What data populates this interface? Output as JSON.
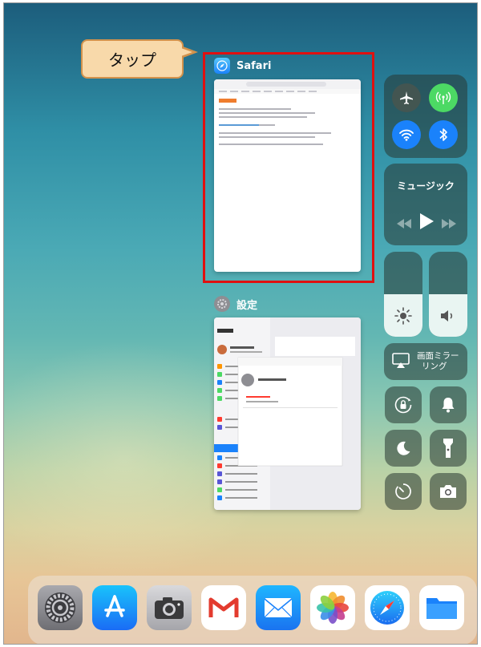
{
  "callout": {
    "label": "タップ"
  },
  "app_switcher": {
    "safari": {
      "name": "Safari",
      "icon": "safari-compass-icon"
    },
    "settings": {
      "name": "設定",
      "icon": "settings-gear-icon"
    }
  },
  "control_center": {
    "music_label": "ミュージック",
    "screen_mirroring_label_line1": "画面ミラー",
    "screen_mirroring_label_line2": "リング",
    "toggles": [
      "airplane-mode-icon",
      "cellular-data-icon",
      "wifi-icon",
      "bluetooth-icon"
    ],
    "sliders": [
      "brightness-icon",
      "volume-icon"
    ],
    "buttons": [
      "orientation-lock-icon",
      "bell-icon",
      "do-not-disturb-moon-icon",
      "flashlight-icon",
      "timer-icon",
      "camera-icon"
    ],
    "accent_green": "#4cd964",
    "accent_blue": "#1a82fb"
  },
  "dock": {
    "apps": [
      "Settings",
      "App Store",
      "Camera",
      "Gmail",
      "Mail",
      "Photos",
      "Safari",
      "Files"
    ]
  }
}
